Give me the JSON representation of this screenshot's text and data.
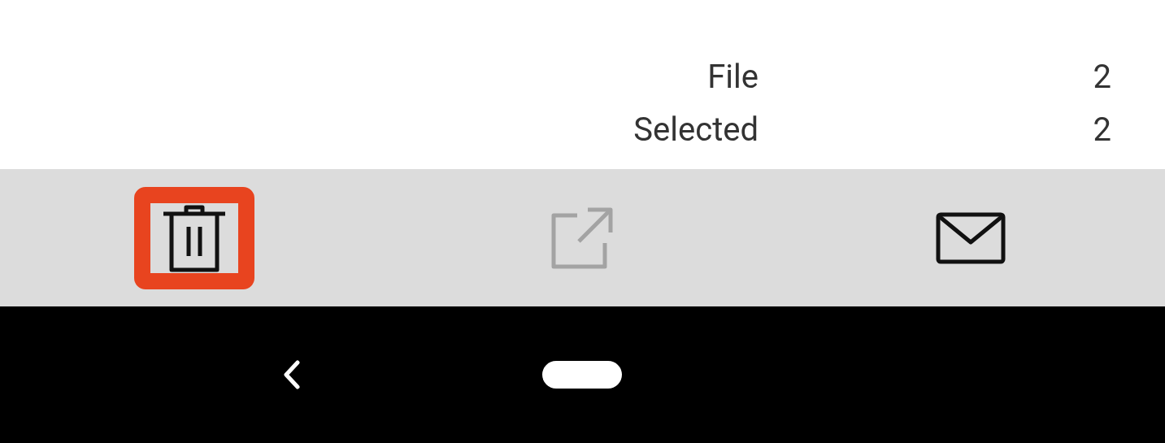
{
  "summary": [
    {
      "label": "File",
      "value": "2"
    },
    {
      "label": "Selected",
      "value": "2"
    }
  ],
  "toolbar": [
    {
      "kind": "delete",
      "highlighted": true,
      "disabled": false
    },
    {
      "kind": "share",
      "highlighted": false,
      "disabled": true
    },
    {
      "kind": "mail",
      "highlighted": false,
      "disabled": false
    }
  ]
}
